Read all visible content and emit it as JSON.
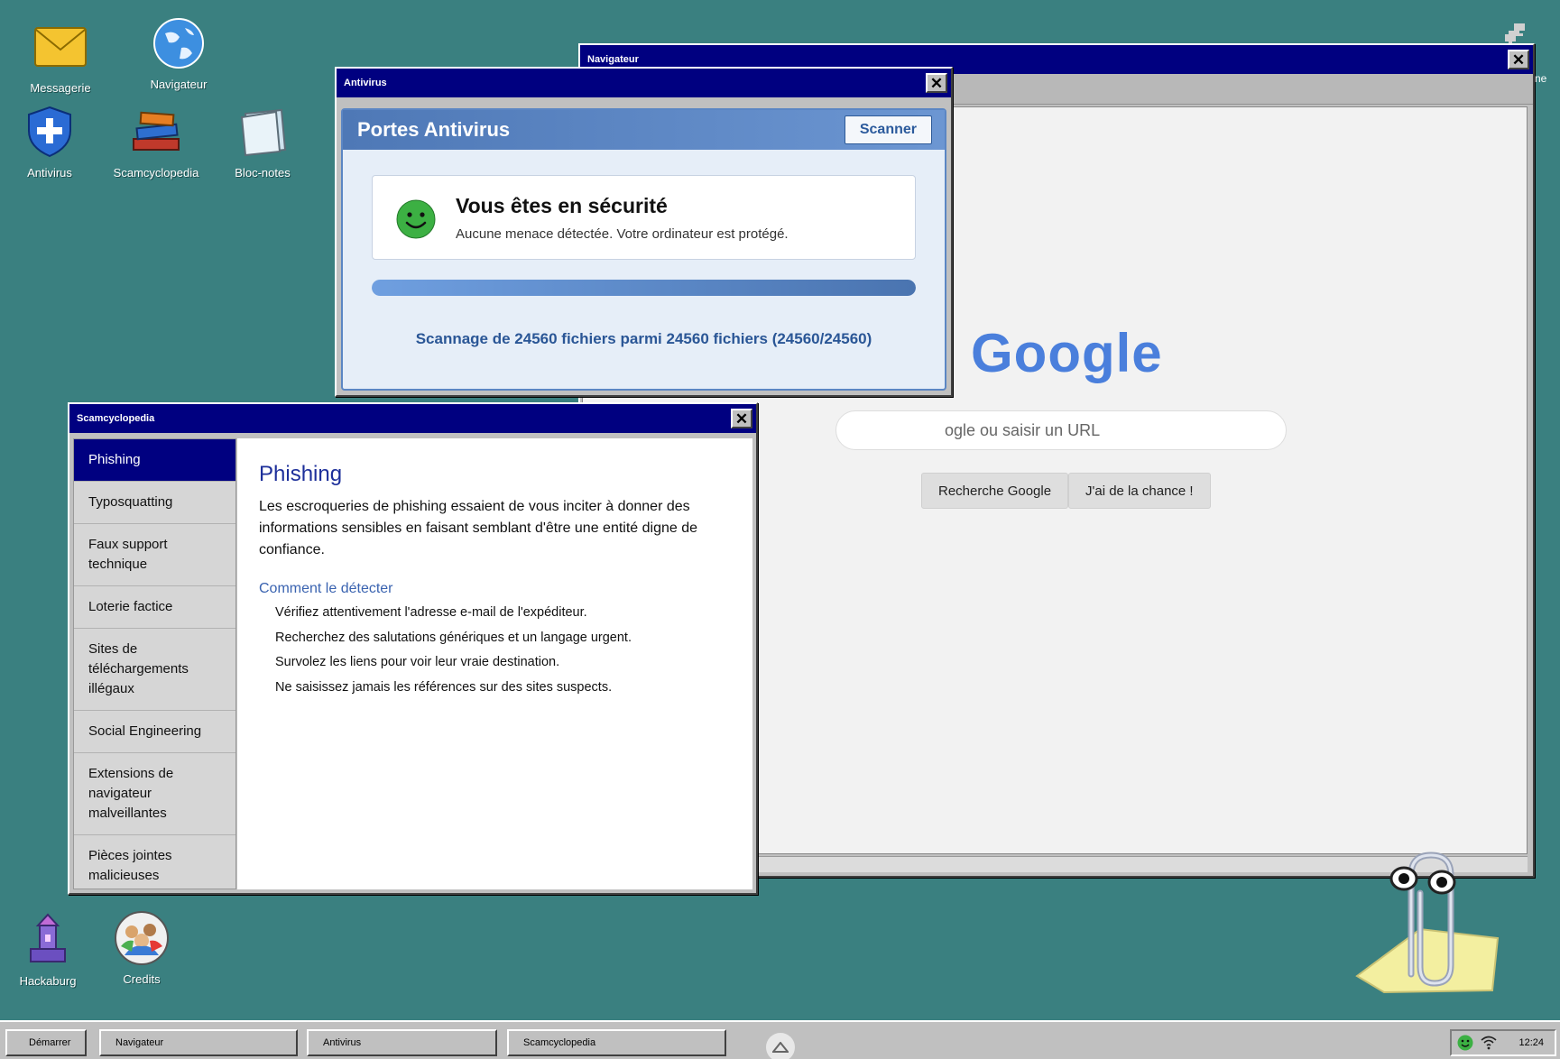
{
  "desktop": {
    "icons": {
      "messagerie": "Messagerie",
      "navigateur": "Navigateur",
      "antivirus": "Antivirus",
      "scamcyclopedia": "Scamcyclopedia",
      "blocnotes": "Bloc-notes",
      "hackaburg": "Hackaburg",
      "credits": "Credits"
    },
    "background_color": "#3a8080"
  },
  "browser": {
    "title": "Navigateur",
    "corner_text": "ne",
    "logo": "Google",
    "search_placeholder": "ogle ou saisir un URL",
    "btn_search": "Recherche Google",
    "btn_lucky": "J'ai de la chance !"
  },
  "antivirus": {
    "title": "Antivirus",
    "app_name": "Portes Antivirus",
    "scan_button": "Scanner",
    "status_title": "Vous êtes en sécurité",
    "status_sub": "Aucune menace détectée. Votre ordinateur est protégé.",
    "progress": 1.0,
    "scan_count": "Scannage de 24560 fichiers parmi 24560 fichiers (24560/24560)"
  },
  "scamcyclopedia": {
    "title": "Scamcyclopedia",
    "sidebar": [
      "Phishing",
      "Typosquatting",
      "Faux support technique",
      "Loterie factice",
      "Sites de téléchargements illégaux",
      "Social Engineering",
      "Extensions de navigateur malveillantes",
      "Pièces jointes malicieuses"
    ],
    "active_index": 0,
    "content": {
      "title": "Phishing",
      "description": "Les escroqueries de phishing essaient de vous inciter à donner des informations sensibles en faisant semblant d'être une entité digne de confiance.",
      "subtitle": "Comment le détecter",
      "tips": [
        "Vérifiez attentivement l'adresse e-mail de l'expéditeur.",
        "Recherchez des salutations génériques et un langage urgent.",
        "Survolez les liens pour voir leur vraie destination.",
        "Ne saisissez jamais les références sur des sites suspects."
      ]
    }
  },
  "taskbar": {
    "start": "Démarrer",
    "tasks": [
      "Navigateur",
      "Antivirus",
      "Scamcyclopedia"
    ],
    "clock": "12:24"
  },
  "colors": {
    "title_bar": "#000080",
    "accent_blue": "#4a7fdc",
    "safe_green": "#3cb043"
  }
}
